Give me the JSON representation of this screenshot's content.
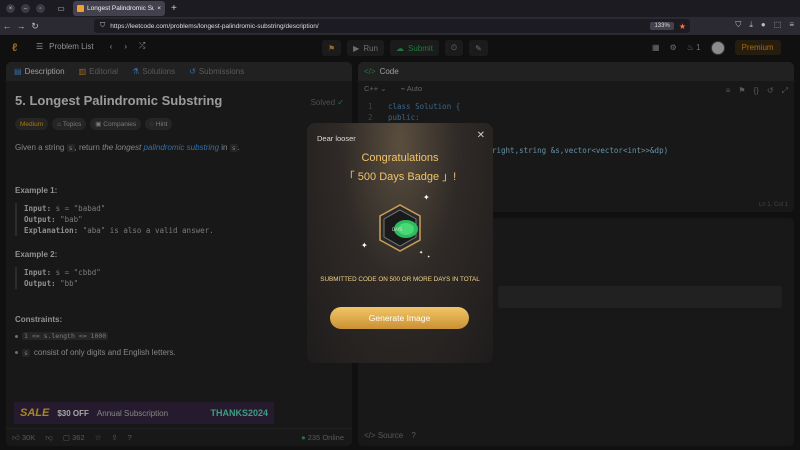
{
  "browser": {
    "tab_title": "Longest Palindromic Sub",
    "url": "https://leetcode.com/problems/longest-palindromic-substring/description/",
    "zoom": "133%"
  },
  "topbar": {
    "problem_list": "Problem List",
    "run": "Run",
    "submit": "Submit",
    "streak": "1",
    "premium": "Premium"
  },
  "left": {
    "tabs": [
      "Description",
      "Editorial",
      "Solutions",
      "Submissions"
    ],
    "title": "5. Longest Palindromic Substring",
    "solved": "Solved",
    "tags": [
      "Medium",
      "Topics",
      "Companies",
      "Hint"
    ],
    "desc_pre": "Given a string ",
    "desc_s": "s",
    "desc_mid": ", return ",
    "desc_em": "the longest ",
    "desc_link": "palindromic substring",
    "desc_in": " in ",
    "desc_s2": "s",
    "desc_end": ".",
    "ex1_h": "Example 1:",
    "ex1_in_label": "Input:",
    "ex1_in": " s = \"babad\"",
    "ex1_out_label": "Output:",
    "ex1_out": " \"bab\"",
    "ex1_expl_label": "Explanation:",
    "ex1_expl": " \"aba\" is also a valid answer.",
    "ex2_h": "Example 2:",
    "ex2_in_label": "Input:",
    "ex2_in": " s = \"cbbd\"",
    "ex2_out_label": "Output:",
    "ex2_out": " \"bb\"",
    "constraints_h": "Constraints:",
    "c1": "1 <= s.length <= 1000",
    "c2_code": "s",
    "c2_text": "consist of only digits and English letters.",
    "promo_sale": "SALE",
    "promo_off": "$30 OFF",
    "promo_text": "Annual Subscription",
    "promo_code": "THANKS2024",
    "likes": "30K",
    "comments": "362",
    "online": "235 Online"
  },
  "right": {
    "code_tab": "Code",
    "lang": "C++",
    "auto": "Auto",
    "lines": [
      {
        "n": "1",
        "t": "class Solution {"
      },
      {
        "n": "2",
        "t": "public:"
      }
    ],
    "code_frag": "right,string &s,vector<vector<int>>&dp)",
    "cursor_pos": "Ln 1, Col 1",
    "source": "Source"
  },
  "modal": {
    "greeting": "Dear looser",
    "title": "Congratulations",
    "badge": "「 500 Days Badge 」!",
    "badge_label": "DAYS",
    "subtitle": "SUBMITTED CODE ON 500 OR MORE DAYS IN TOTAL",
    "button": "Generate Image"
  }
}
